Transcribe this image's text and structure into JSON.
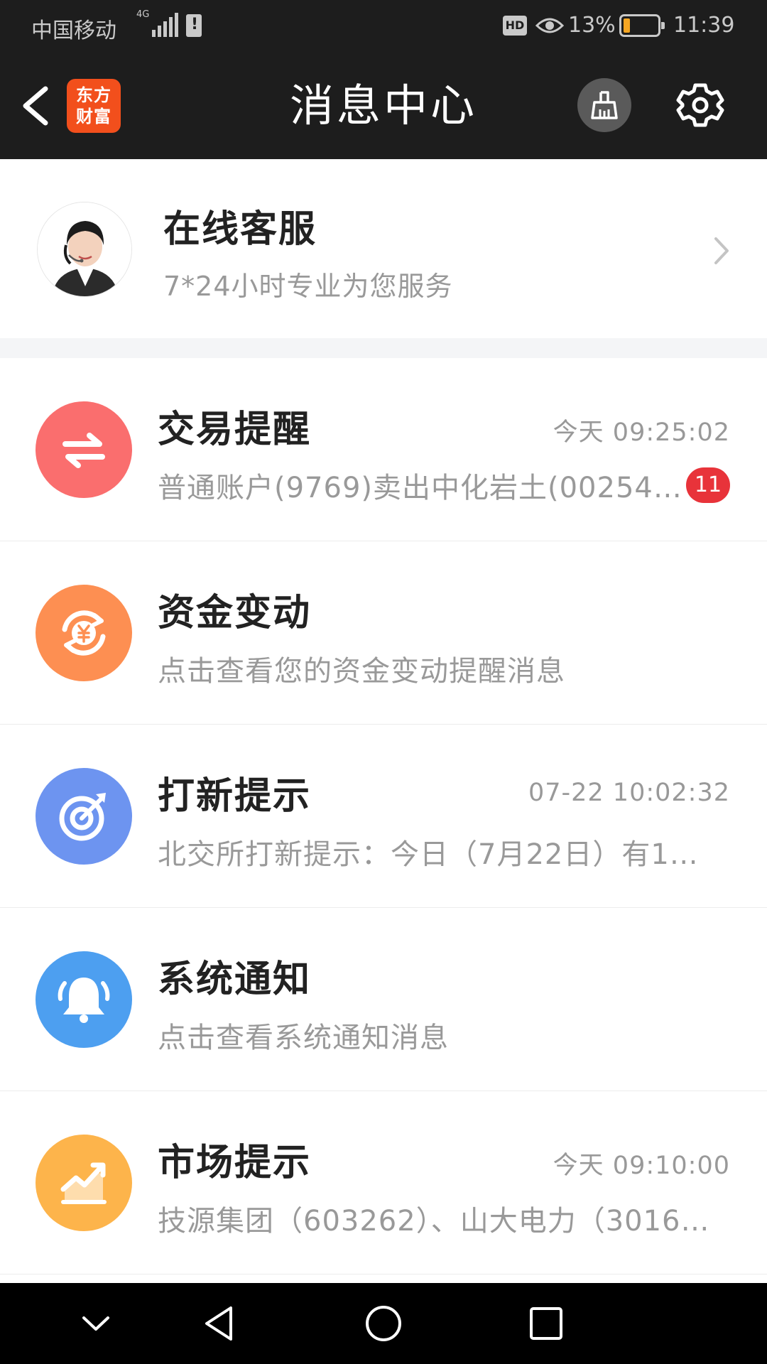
{
  "status_bar": {
    "carrier": "中国移动",
    "network": "4G",
    "battery_percent": "13%",
    "time": "11:39"
  },
  "header": {
    "logo_line1": "东方",
    "logo_line2": "财富",
    "title": "消息中心"
  },
  "customer_service": {
    "title": "在线客服",
    "subtitle": "7*24小时专业为您服务"
  },
  "messages": [
    {
      "title": "交易提醒",
      "time": "今天 09:25:02",
      "preview": "普通账户(9769)卖出中化岩土(00254…",
      "badge": "11",
      "icon": "exchange-arrows-icon",
      "color": "#fa6e6e"
    },
    {
      "title": "资金变动",
      "time": "",
      "preview": "点击查看您的资金变动提醒消息",
      "icon": "yuan-cycle-icon",
      "color": "#fd8f52"
    },
    {
      "title": "打新提示",
      "time": "07-22 10:02:32",
      "preview": "北交所打新提示：今日（7月22日）有1…",
      "icon": "target-icon",
      "color": "#6d94f0"
    },
    {
      "title": "系统通知",
      "time": "",
      "preview": "点击查看系统通知消息",
      "icon": "bell-icon",
      "color": "#4d9ff0"
    },
    {
      "title": "市场提示",
      "time": "今天 09:10:00",
      "preview": "技源集团（603262）、山大电力（3016…",
      "icon": "trend-chart-icon",
      "color": "#fdb44b"
    }
  ],
  "colors": {
    "header_bg": "#1d1d1d",
    "badge": "#e8333a",
    "logo": "#f24f1c"
  }
}
